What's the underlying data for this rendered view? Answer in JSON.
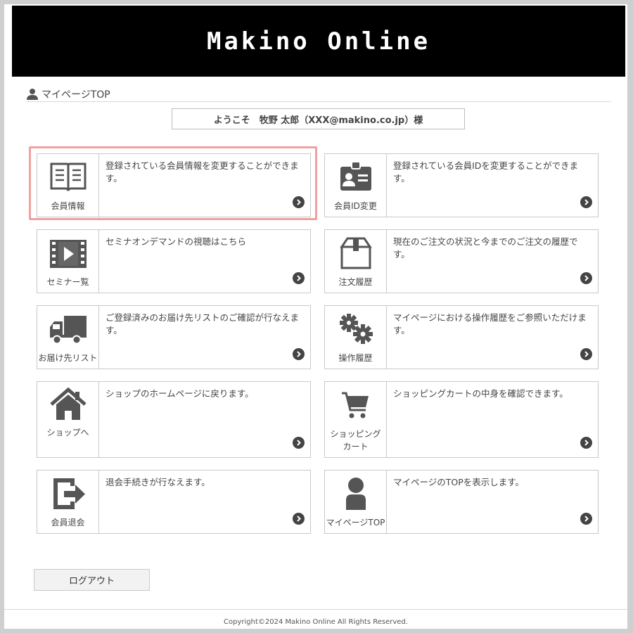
{
  "header": {
    "logo_text": "Makino Online"
  },
  "breadcrumb": {
    "icon": "person-icon",
    "label": "マイページTOP"
  },
  "welcome": {
    "text": "ようこそ　牧野 太郎（XXX@makino.co.jp）様"
  },
  "cards": [
    {
      "label": "会員情報",
      "icon": "book-icon",
      "desc": "登録されている会員情報を変更することができます。",
      "highlighted": true
    },
    {
      "label": "会員ID変更",
      "icon": "id-card-icon",
      "desc": "登録されている会員IDを変更することができます。"
    },
    {
      "label": "セミナー覧",
      "icon": "film-play-icon",
      "desc": "セミナオンデマンドの視聴はこちら"
    },
    {
      "label": "注文履歴",
      "icon": "box-icon",
      "desc": "現在のご注文の状況と今までのご注文の履歴です。"
    },
    {
      "label": "お届け先リスト",
      "icon": "truck-icon",
      "desc": "ご登録済みのお届け先リストのご確認が行なえます。"
    },
    {
      "label": "操作履歴",
      "icon": "gears-icon",
      "desc": "マイページにおける操作履歴をご参照いただけます。"
    },
    {
      "label": "ショップへ",
      "icon": "home-icon",
      "desc": "ショップのホームページに戻ります。"
    },
    {
      "label": "ショッピング\nカート",
      "label_line1": "ショッピング",
      "label_line2": "カート",
      "icon": "cart-icon",
      "desc": "ショッピングカートの中身を確認できます。"
    },
    {
      "label": "会員退会",
      "icon": "exit-icon",
      "desc": "退会手続きが行なえます。"
    },
    {
      "label": "マイページTOP",
      "icon": "user-icon",
      "desc": "マイページのTOPを表示します。"
    }
  ],
  "logout": {
    "label": "ログアウト"
  },
  "footer": {
    "copyright": "Copyright©2024 Makino Online All Rights Reserved."
  },
  "colors": {
    "highlight": "#f0a0a0",
    "banner": "#000000",
    "icon": "#555555"
  }
}
